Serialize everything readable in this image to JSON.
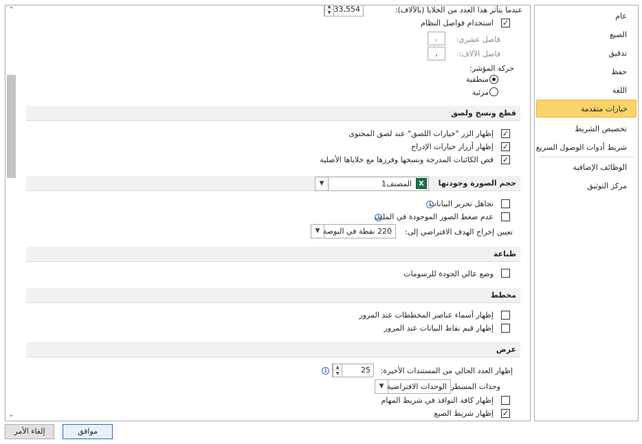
{
  "nav": {
    "items": [
      {
        "label": "عام"
      },
      {
        "label": "الصيغ"
      },
      {
        "label": "تدقيق"
      },
      {
        "label": "حفظ"
      },
      {
        "label": "اللغة"
      },
      {
        "label": "خيارات متقدمة",
        "selected": true
      },
      {
        "label": "تخصيص الشريط"
      },
      {
        "label": "شريط أدوات الوصول السريع"
      },
      {
        "label": "الوظائف الإضافية"
      },
      {
        "label": "مركز التوثيق"
      }
    ]
  },
  "top": {
    "cells_warning_label": "عندما يتأثر هذا العدد من الخلايا (بالآلاف):",
    "cells_warning_value": "33,554",
    "use_system_separators": {
      "label": "استخدام فواصل النظام",
      "checked": true
    },
    "decimal_separator": {
      "label": "فاصل عشري:",
      "value": "."
    },
    "thousands_separator": {
      "label": "فاصل الآلاف:",
      "value": ","
    },
    "cursor_movement": {
      "label": "حركة المؤشر:",
      "options": [
        {
          "label": "منطقية",
          "selected": true
        },
        {
          "label": "مرئية",
          "selected": false
        }
      ]
    }
  },
  "cut_copy_paste": {
    "title": "قطع ونسخ ولصق",
    "options": [
      {
        "label": "إظهار الزر \"خيارات اللصق\" عند لصق المحتوى",
        "checked": true
      },
      {
        "label": "إظهار أزرار خيارات الإدراج",
        "checked": true
      },
      {
        "label": "قص الكائنات المدرجة ونسخها وفرزها مع خلاياها الأصلية",
        "checked": true
      }
    ]
  },
  "image_size": {
    "title": "حجم الصورة وجودتها",
    "workbook": "المصنف1",
    "workbook_icon": "excel-icon",
    "discard_editing": {
      "label": "تجاهل تحرير البيانات",
      "checked": false
    },
    "no_compress": {
      "label": "عدم ضغط الصور الموجودة في الملف",
      "checked": false
    },
    "default_output_label": "تعيين إخراج الهدف الافتراضي إلى:",
    "default_output_value": "220 نقطة في البوصة"
  },
  "print": {
    "title": "طباعة",
    "high_quality": {
      "label": "وضع عالي الجودة للرسومات",
      "checked": false
    }
  },
  "chart": {
    "title": "مخطط",
    "show_names": {
      "label": "إظهار أسماء عناصر المخططات عند المرور",
      "checked": false
    },
    "show_values": {
      "label": "إظهار قيم نقاط البيانات عند المرور",
      "checked": false
    }
  },
  "display": {
    "title": "عرض",
    "recent_docs_label": "إظهار العدد الحالي من المستندات الأخيرة:",
    "recent_docs_value": "25",
    "ruler_units_label": "وحدات المسطرة",
    "ruler_units_value": "الوحدات الافتراضية",
    "show_all_windows": {
      "label": "إظهار كافة النوافذ في شريط المهام",
      "checked": false
    },
    "show_formula_bar": {
      "label": "إظهار شريط الصيغ",
      "checked": true
    }
  },
  "buttons": {
    "ok": "موافق",
    "cancel": "إلغاء الأمر"
  },
  "colors": {
    "selected_nav_bg": "#fcd36a",
    "section_bg": "#f1f1f1",
    "excel_green": "#1e7145"
  }
}
